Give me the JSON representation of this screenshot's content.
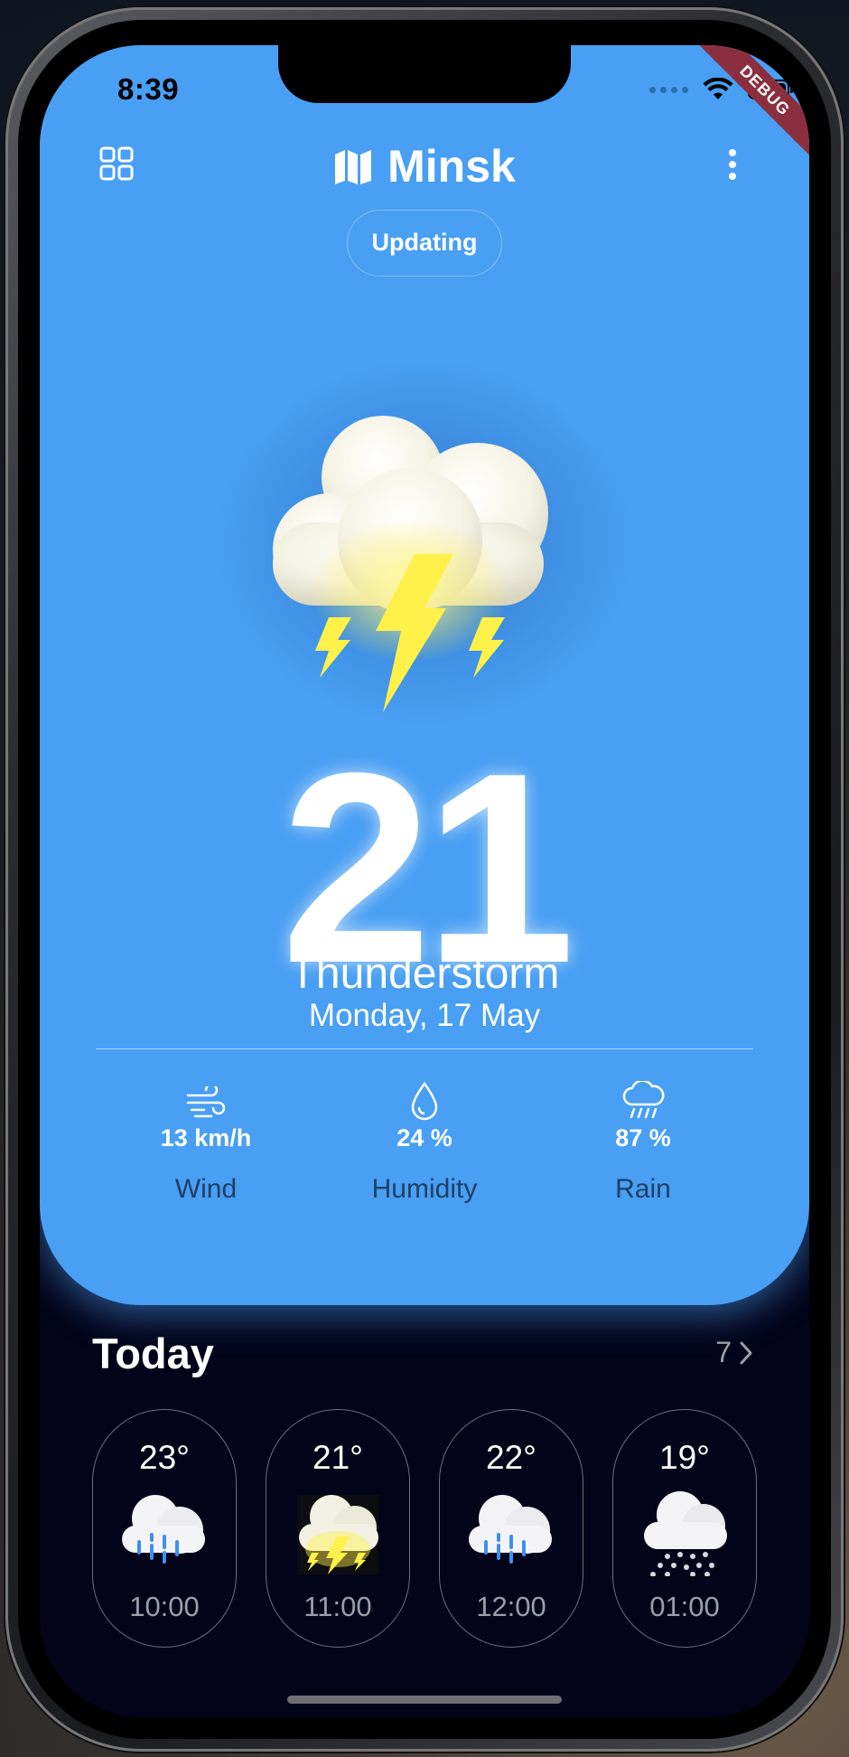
{
  "status_bar": {
    "time": "8:39",
    "debug_label": "DEBUG"
  },
  "header": {
    "city": "Minsk",
    "status_pill": "Updating"
  },
  "current": {
    "temperature": "21",
    "condition": "Thunderstorm",
    "date": "Monday, 17 May"
  },
  "stats": [
    {
      "icon": "wind-icon",
      "value": "13 km/h",
      "label": "Wind"
    },
    {
      "icon": "humidity-drop-icon",
      "value": "24 %",
      "label": "Humidity"
    },
    {
      "icon": "rain-cloud-icon",
      "value": "87 %",
      "label": "Rain"
    }
  ],
  "today": {
    "title": "Today",
    "more_label": "7",
    "hours": [
      {
        "temp": "23°",
        "time": "10:00",
        "icon": "rain-cloud-icon"
      },
      {
        "temp": "21°",
        "time": "11:00",
        "icon": "thunder-cloud-icon"
      },
      {
        "temp": "22°",
        "time": "12:00",
        "icon": "rain-cloud-icon"
      },
      {
        "temp": "19°",
        "time": "01:00",
        "icon": "snow-cloud-icon"
      }
    ]
  },
  "colors": {
    "card_blue": "#489ff3",
    "background_dark": "#03041a",
    "lightning_yellow": "#fff14a"
  }
}
